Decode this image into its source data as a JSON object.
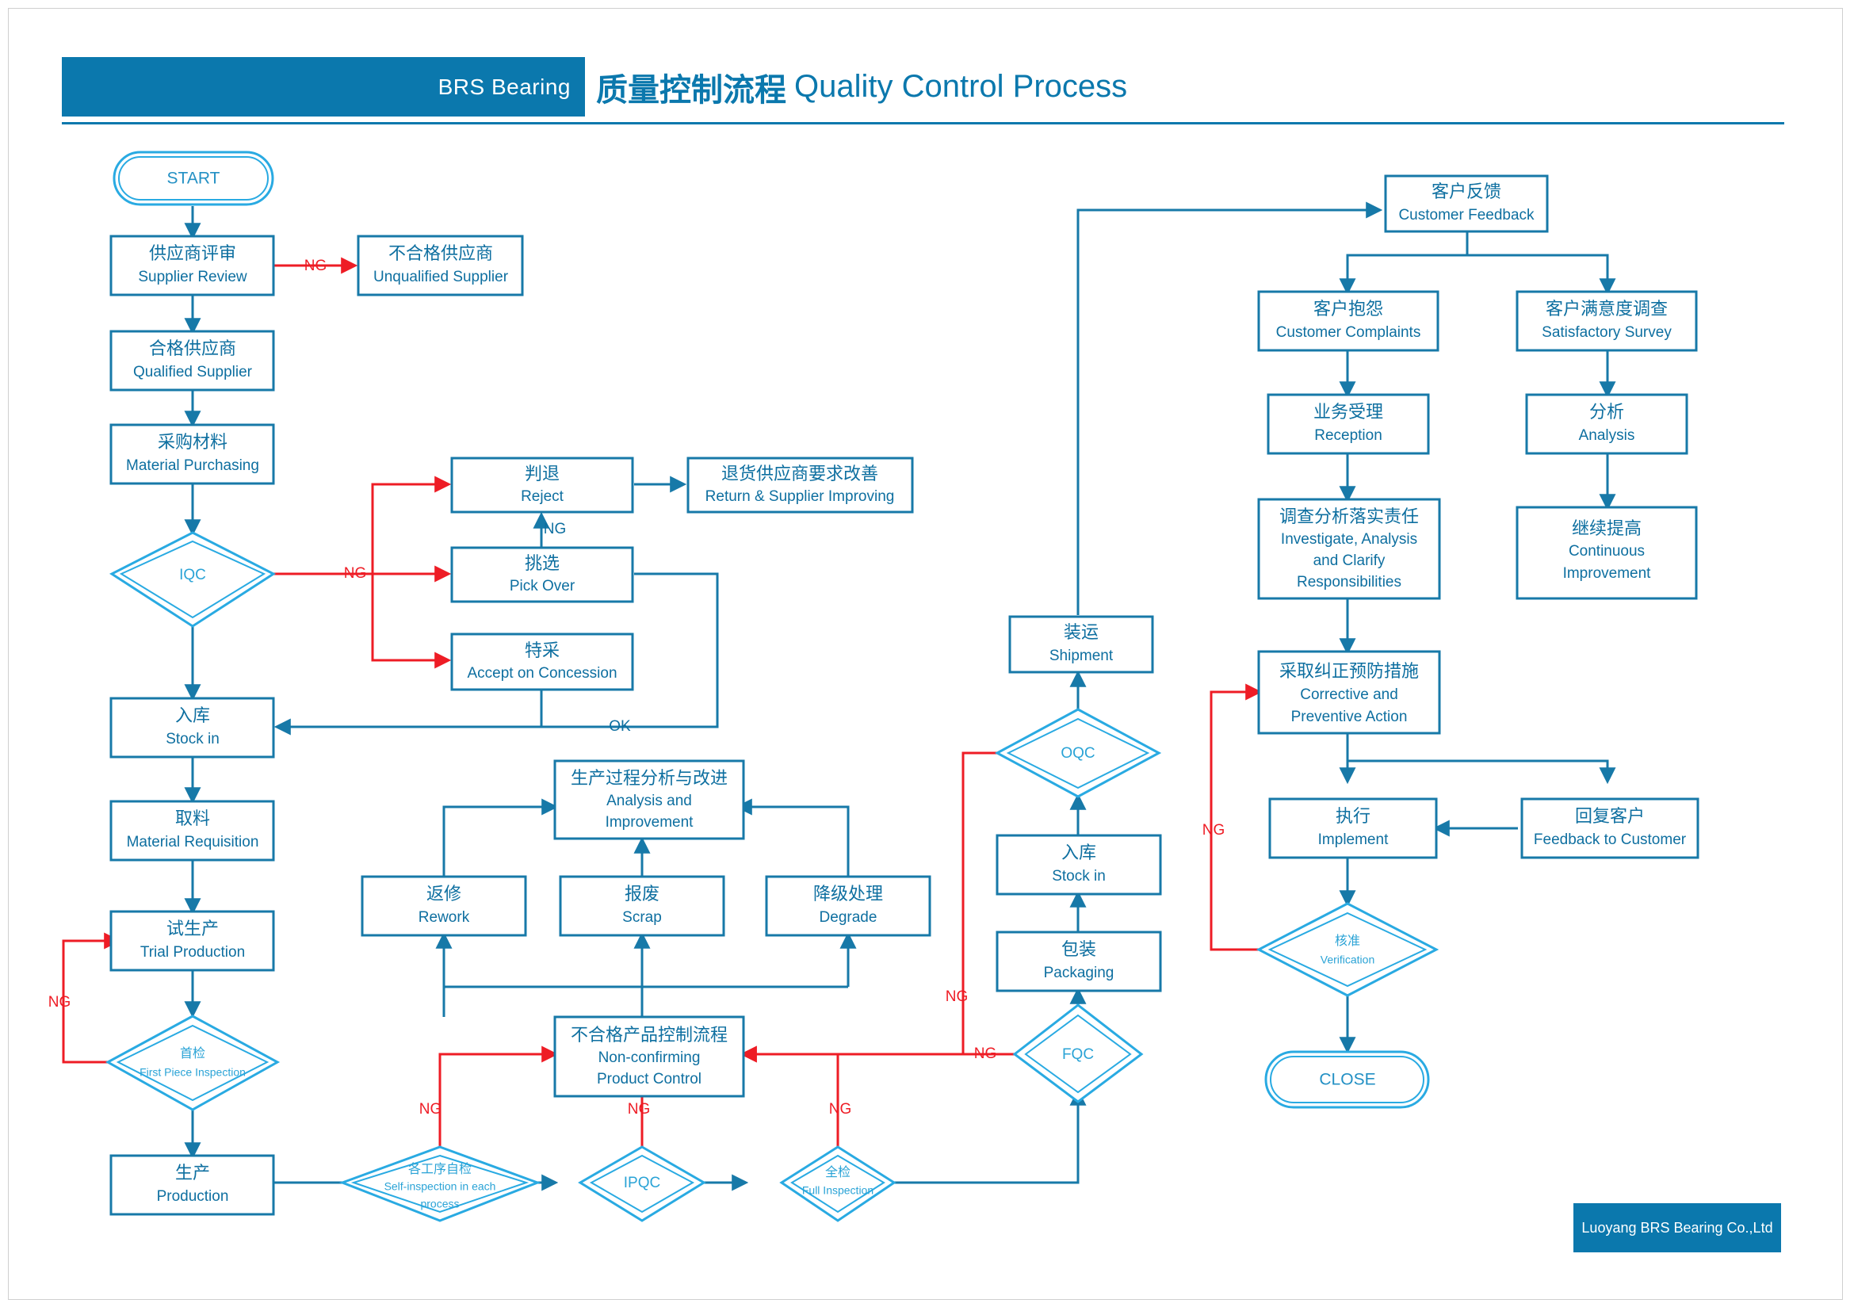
{
  "header": {
    "brand": "BRS Bearing",
    "title_cn": "质量控制流程",
    "title_en": "Quality Control Process"
  },
  "footer": {
    "company": "Luoyang BRS Bearing Co.,Ltd"
  },
  "nodes": {
    "start": {
      "cn": "",
      "en": "START"
    },
    "close": {
      "cn": "",
      "en": "CLOSE"
    },
    "supplier_review": {
      "cn": "供应商评审",
      "en": "Supplier Review"
    },
    "unqualified": {
      "cn": "不合格供应商",
      "en": "Unqualified Supplier"
    },
    "qualified": {
      "cn": "合格供应商",
      "en": "Qualified Supplier"
    },
    "material_purchase": {
      "cn": "采购材料",
      "en": "Material Purchasing"
    },
    "iqc": {
      "cn": "",
      "en": "IQC"
    },
    "reject": {
      "cn": "判退",
      "en": "Reject"
    },
    "return_supplier": {
      "cn": "退货供应商要求改善",
      "en": "Return & Supplier Improving"
    },
    "pick_over": {
      "cn": "挑选",
      "en": "Pick Over"
    },
    "concession": {
      "cn": "特采",
      "en": "Accept on Concession"
    },
    "stock_in_1": {
      "cn": "入库",
      "en": "Stock in"
    },
    "material_req": {
      "cn": "取料",
      "en": "Material Requisition"
    },
    "trial_production": {
      "cn": "试生产",
      "en": "Trial Production"
    },
    "first_piece": {
      "cn": "首检",
      "en": "First Piece Inspection"
    },
    "production": {
      "cn": "生产",
      "en": "Production"
    },
    "self_inspection": {
      "cn": "各工序自检",
      "en": "Self-inspection in each process"
    },
    "ipqc": {
      "cn": "",
      "en": "IPQC"
    },
    "full_inspection": {
      "cn": "全检",
      "en": "Full Inspection"
    },
    "nonconforming": {
      "cn": "不合格产品控制流程",
      "en": "Non-confirming Product Control"
    },
    "rework": {
      "cn": "返修",
      "en": "Rework"
    },
    "scrap": {
      "cn": "报废",
      "en": "Scrap"
    },
    "degrade": {
      "cn": "降级处理",
      "en": "Degrade"
    },
    "analysis_improve": {
      "cn": "生产过程分析与改进",
      "en": "Analysis and Improvement"
    },
    "fqc": {
      "cn": "",
      "en": "FQC"
    },
    "packaging": {
      "cn": "包装",
      "en": "Packaging"
    },
    "stock_in_2": {
      "cn": "入库",
      "en": "Stock in"
    },
    "oqc": {
      "cn": "",
      "en": "OQC"
    },
    "shipment": {
      "cn": "装运",
      "en": "Shipment"
    },
    "customer_feedback": {
      "cn": "客户反馈",
      "en": "Customer Feedback"
    },
    "customer_complaints": {
      "cn": "客户抱怨",
      "en": "Customer Complaints"
    },
    "satisfactory_survey": {
      "cn": "客户满意度调查",
      "en": "Satisfactory Survey"
    },
    "reception": {
      "cn": "业务受理",
      "en": "Reception"
    },
    "analysis": {
      "cn": "分析",
      "en": "Analysis"
    },
    "investigate": {
      "cn": "调查分析落实责任",
      "en": "Investigate, Analysis and Clarify Responsibilities"
    },
    "continuous_improve": {
      "cn": "继续提高",
      "en": "Continuous Improvement"
    },
    "corrective": {
      "cn": "采取纠正预防措施",
      "en": "Corrective and Preventive Action"
    },
    "implement": {
      "cn": "执行",
      "en": "Implement"
    },
    "feedback_customer": {
      "cn": "回复客户",
      "en": "Feedback to Customer"
    },
    "verification": {
      "cn": "核准",
      "en": "Verification"
    }
  },
  "edge_labels": {
    "ng": "NG",
    "ok": "OK"
  },
  "colors": {
    "brand_blue": "#0b78ad",
    "node_stroke": "#1779a8",
    "diamond_stroke": "#29aae2",
    "reject_red": "#ee1c25",
    "text_blue": "#0e6fa0"
  }
}
